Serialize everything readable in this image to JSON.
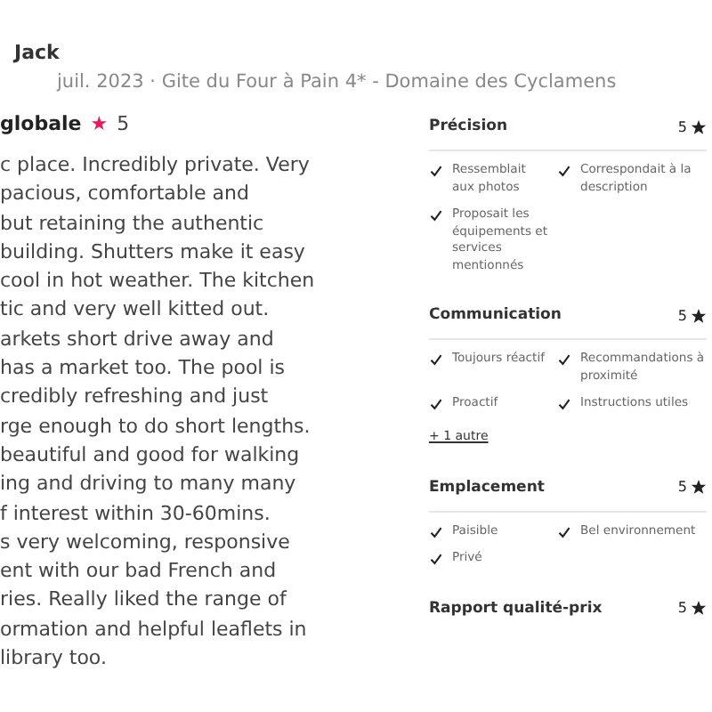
{
  "reviewer": {
    "name": "Jack",
    "meta": "juil. 2023 · Gite du Four à Pain 4* - Domaine des Cyclamens"
  },
  "overall": {
    "label": "globale",
    "star": "★",
    "score": "5"
  },
  "review_lines": [
    "c place. Incredibly private. Very",
    "pacious, comfortable and",
    "but retaining the authentic",
    "building. Shutters make it easy",
    "cool in hot weather. The kitchen",
    "tic and very well kitted out.",
    "arkets short drive away and",
    "has a market too. The pool is",
    "credibly refreshing and just",
    "rge enough to do short lengths.",
    "beautiful and good for walking",
    "ing and driving to many many",
    "f interest within 30-60mins.",
    "s very welcoming, responsive",
    "ent with our bad French and",
    "ries. Really liked the range of",
    "ormation and helpful leaflets in",
    "library too."
  ],
  "categories": [
    {
      "title": "Précision",
      "score": "5",
      "items": [
        "Ressemblait aux photos",
        "Correspondait à la description",
        "Proposait les équipements et services mentionnés"
      ]
    },
    {
      "title": "Communication",
      "score": "5",
      "items": [
        "Toujours réactif",
        "Recommandations à proximité",
        "Proactif",
        "Instructions utiles"
      ],
      "more": "+ 1 autre"
    },
    {
      "title": "Emplacement",
      "score": "5",
      "items": [
        "Paisible",
        "Bel environnement",
        "Privé"
      ]
    },
    {
      "title": "Rapport qualité-prix",
      "score": "5"
    }
  ]
}
